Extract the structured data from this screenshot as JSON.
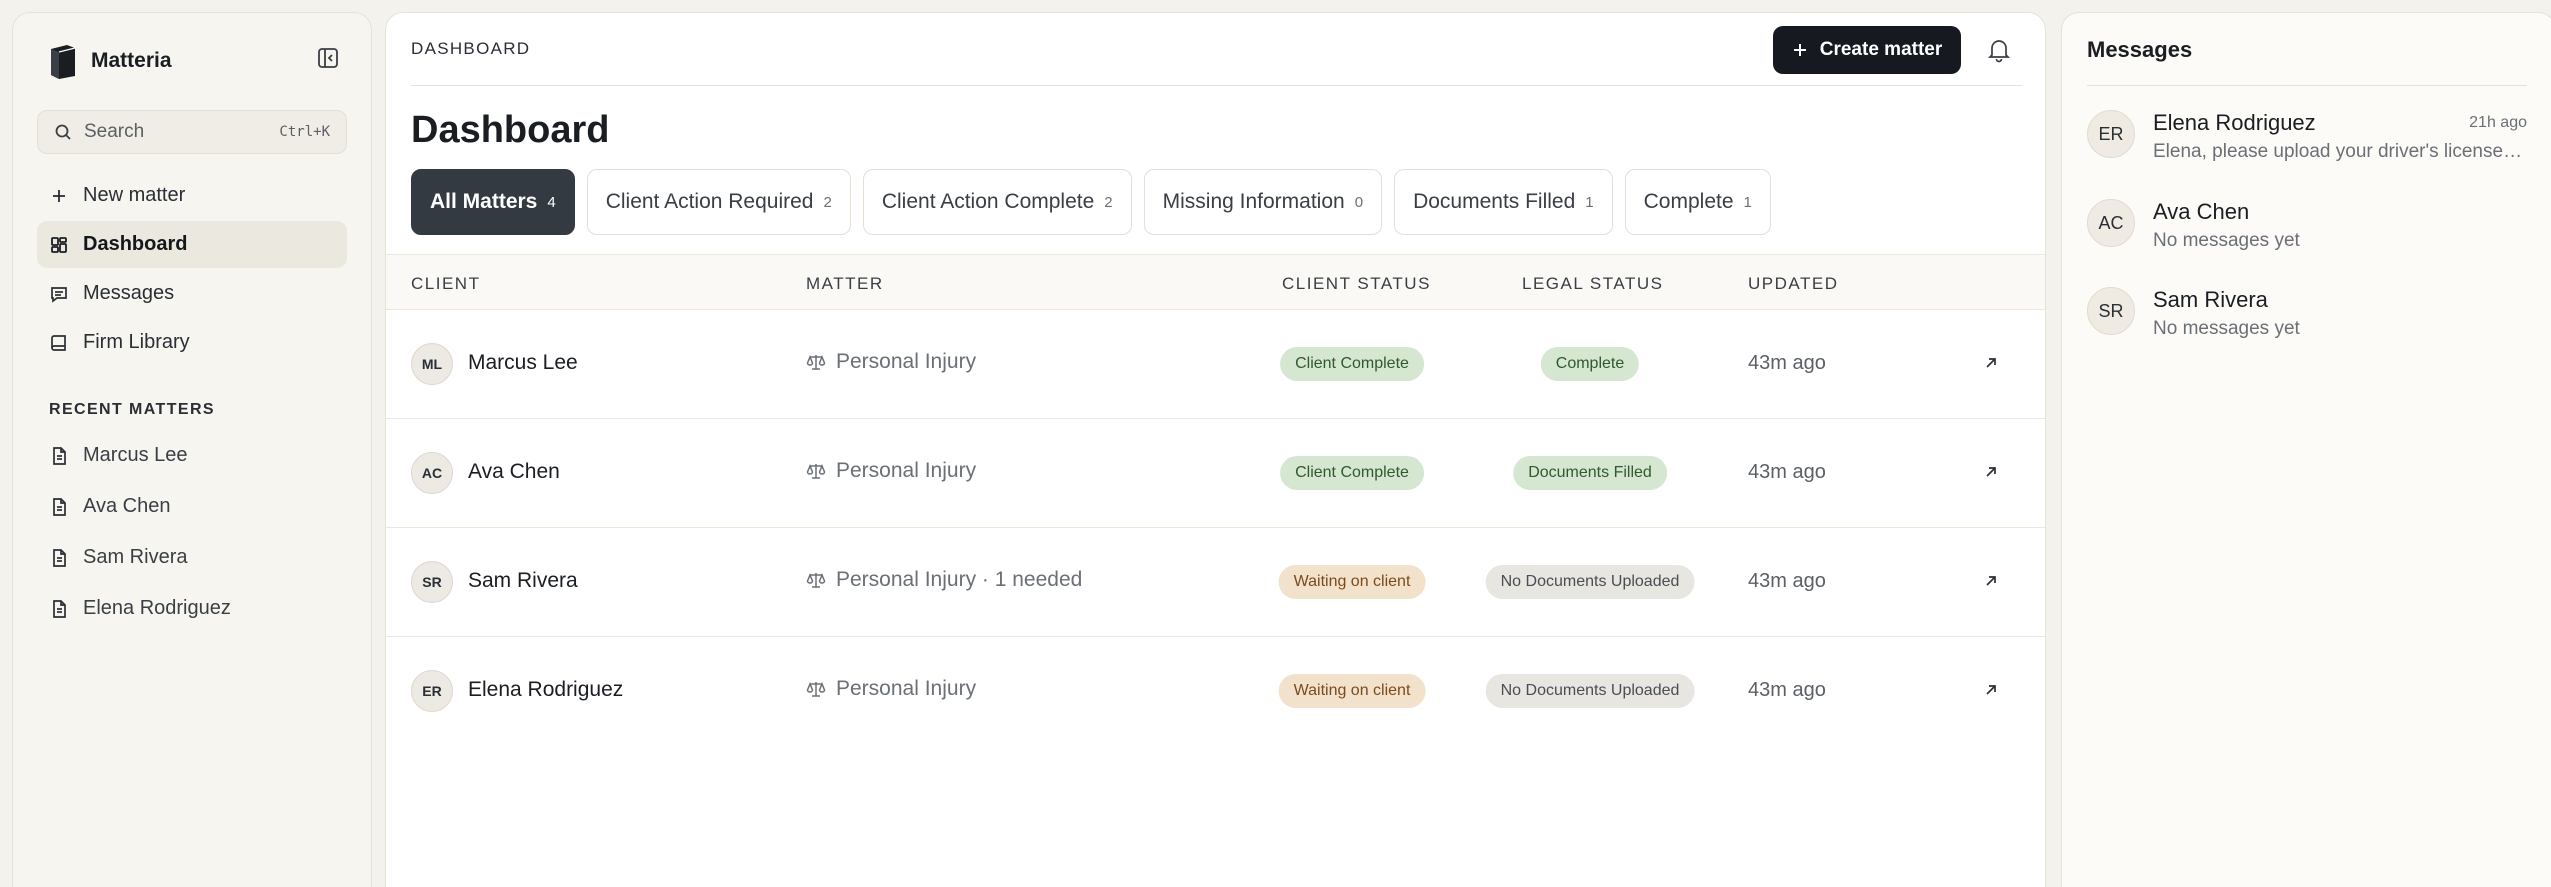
{
  "brand": {
    "name": "Matteria",
    "logo_icon": "book-icon"
  },
  "search": {
    "label": "Search",
    "shortcut": "Ctrl+K"
  },
  "nav": {
    "items": [
      {
        "label": "New matter",
        "icon": "plus-icon"
      },
      {
        "label": "Dashboard",
        "icon": "grid-icon",
        "active": true
      },
      {
        "label": "Messages",
        "icon": "message-icon"
      },
      {
        "label": "Firm Library",
        "icon": "library-icon"
      }
    ]
  },
  "recent": {
    "title": "RECENT MATTERS",
    "items": [
      {
        "label": "Marcus Lee"
      },
      {
        "label": "Ava Chen"
      },
      {
        "label": "Sam Rivera"
      },
      {
        "label": "Elena Rodriguez"
      }
    ]
  },
  "header": {
    "breadcrumb": "DASHBOARD",
    "create_label": "Create matter"
  },
  "page": {
    "title": "Dashboard"
  },
  "tabs": [
    {
      "label": "All Matters",
      "count": "4",
      "active": true
    },
    {
      "label": "Client Action Required",
      "count": "2"
    },
    {
      "label": "Client Action Complete",
      "count": "2"
    },
    {
      "label": "Missing Information",
      "count": "0"
    },
    {
      "label": "Documents Filled",
      "count": "1"
    },
    {
      "label": "Complete",
      "count": "1"
    }
  ],
  "table": {
    "columns": {
      "client": "CLIENT",
      "matter": "MATTER",
      "client_status": "CLIENT STATUS",
      "legal_status": "LEGAL STATUS",
      "updated": "UPDATED"
    },
    "rows": [
      {
        "initials": "ML",
        "client": "Marcus Lee",
        "matter": "Personal Injury",
        "client_status": "Client Complete",
        "client_status_tone": "green",
        "legal_status": "Complete",
        "legal_status_tone": "green",
        "updated": "43m ago"
      },
      {
        "initials": "AC",
        "client": "Ava Chen",
        "matter": "Personal Injury",
        "client_status": "Client Complete",
        "client_status_tone": "green",
        "legal_status": "Documents Filled",
        "legal_status_tone": "green",
        "updated": "43m ago"
      },
      {
        "initials": "SR",
        "client": "Sam Rivera",
        "matter": "Personal Injury · 1 needed",
        "client_status": "Waiting on client",
        "client_status_tone": "amber",
        "legal_status": "No Documents Uploaded",
        "legal_status_tone": "gray",
        "updated": "43m ago"
      },
      {
        "initials": "ER",
        "client": "Elena Rodriguez",
        "matter": "Personal Injury",
        "client_status": "Waiting on client",
        "client_status_tone": "amber",
        "legal_status": "No Documents Uploaded",
        "legal_status_tone": "gray",
        "updated": "43m ago"
      }
    ]
  },
  "messages": {
    "title": "Messages",
    "items": [
      {
        "initials": "ER",
        "name": "Elena Rodriguez",
        "time": "21h ago",
        "preview": "Elena, please upload your driver's license and insurance card"
      },
      {
        "initials": "AC",
        "name": "Ava Chen",
        "time": "",
        "preview": "No messages yet"
      },
      {
        "initials": "SR",
        "name": "Sam Rivera",
        "time": "",
        "preview": "No messages yet"
      }
    ]
  },
  "colors": {
    "accent_dark": "#161a20",
    "pill_green_bg": "#d5e6d1",
    "pill_amber_bg": "#f2e2cc",
    "pill_gray_bg": "#e8e6e0"
  }
}
